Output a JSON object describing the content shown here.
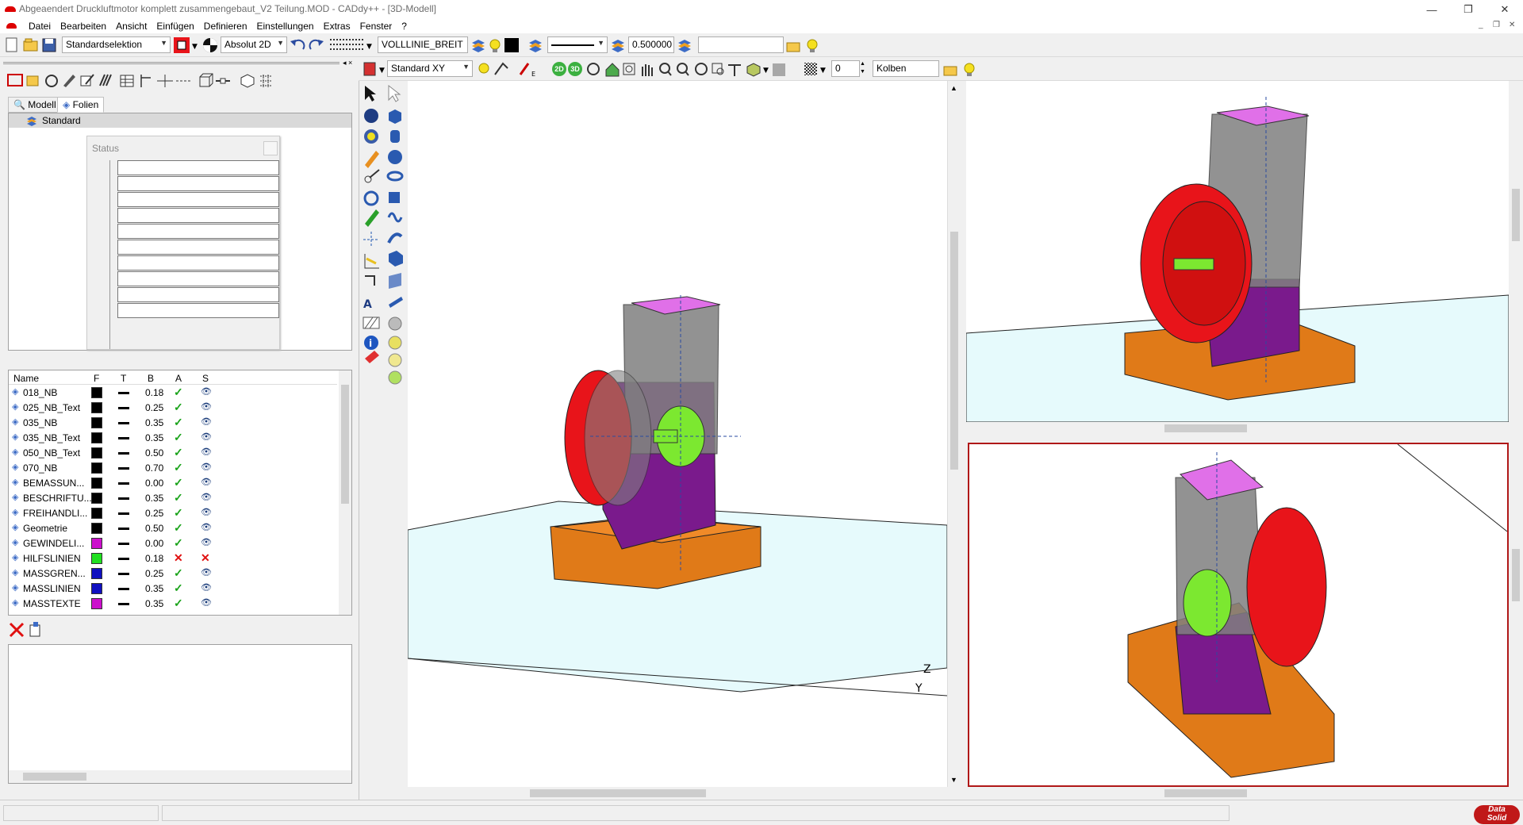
{
  "window": {
    "title": "Abgeaendert Druckluftmotor komplett zusammengebaut_V2 Teilung.MOD  -  CADdy++ - [3D-Modell]",
    "minimize": "—",
    "restore": "❐",
    "close": "✕"
  },
  "menu": {
    "items": [
      "Datei",
      "Bearbeiten",
      "Ansicht",
      "Einfügen",
      "Definieren",
      "Einstellungen",
      "Extras",
      "Fenster",
      "?"
    ],
    "mdi_min": "_",
    "mdi_restore": "❐",
    "mdi_close": "✕"
  },
  "toolbar1": {
    "selection_mode": "Standardselektion",
    "coord_mode": "Absolut 2D",
    "line_type": "VOLLLINIE_BREIT",
    "line_width": "0.500000",
    "text_field": ""
  },
  "toolbar2": {
    "view_select": "Standard XY",
    "btn_2d": "2D",
    "btn_3d": "3D",
    "layer_num": "0",
    "part_name": "Kolben"
  },
  "left_panel": {
    "tabs": [
      "Modell",
      "Folien"
    ],
    "active_tab": "Folien",
    "tree_root": "Standard",
    "status_title": "Status",
    "columns": [
      "Name",
      "F",
      "T",
      "B",
      "A",
      "S"
    ],
    "layers": [
      {
        "name": "018_NB",
        "color": "#000000",
        "width": "0.18",
        "a": "check",
        "s": "eye"
      },
      {
        "name": "025_NB_Text",
        "color": "#000000",
        "width": "0.25",
        "a": "check",
        "s": "eye"
      },
      {
        "name": "035_NB",
        "color": "#000000",
        "width": "0.35",
        "a": "check",
        "s": "eye"
      },
      {
        "name": "035_NB_Text",
        "color": "#000000",
        "width": "0.35",
        "a": "check",
        "s": "eye"
      },
      {
        "name": "050_NB_Text",
        "color": "#000000",
        "width": "0.50",
        "a": "check",
        "s": "eye"
      },
      {
        "name": "070_NB",
        "color": "#000000",
        "width": "0.70",
        "a": "check",
        "s": "eye"
      },
      {
        "name": "BEMASSUN...",
        "color": "#000000",
        "width": "0.00",
        "a": "check",
        "s": "eye"
      },
      {
        "name": "BESCHRIFTU...",
        "color": "#000000",
        "width": "0.35",
        "a": "check",
        "s": "eye"
      },
      {
        "name": "FREIHANDLI...",
        "color": "#000000",
        "width": "0.25",
        "a": "check",
        "s": "eye"
      },
      {
        "name": "Geometrie",
        "color": "#000000",
        "width": "0.50",
        "a": "check",
        "s": "eye"
      },
      {
        "name": "GEWINDELI...",
        "color": "#cc10cc",
        "width": "0.00",
        "a": "check",
        "s": "eye"
      },
      {
        "name": "HILFSLINIEN",
        "color": "#20e020",
        "width": "0.18",
        "a": "cross",
        "s": "hidden"
      },
      {
        "name": "MASSGREN...",
        "color": "#1010c0",
        "width": "0.25",
        "a": "check",
        "s": "eye"
      },
      {
        "name": "MASSLINIEN",
        "color": "#1010c0",
        "width": "0.35",
        "a": "check",
        "s": "eye"
      },
      {
        "name": "MASSTEXTE",
        "color": "#cc10cc",
        "width": "0.35",
        "a": "check",
        "s": "eye"
      }
    ]
  },
  "viewports": {
    "main_axis_z": "Z",
    "main_axis_y": "Y"
  },
  "colors": {
    "flywheel": "#e8141a",
    "base": "#e07a18",
    "frame": "#7a1a8c",
    "top": "#e070e8",
    "crank": "#7ce830",
    "floor": "#e6fafc",
    "active_border": "#b01818"
  },
  "branding": {
    "logo_line1": "Data",
    "logo_line2": "Solid"
  }
}
